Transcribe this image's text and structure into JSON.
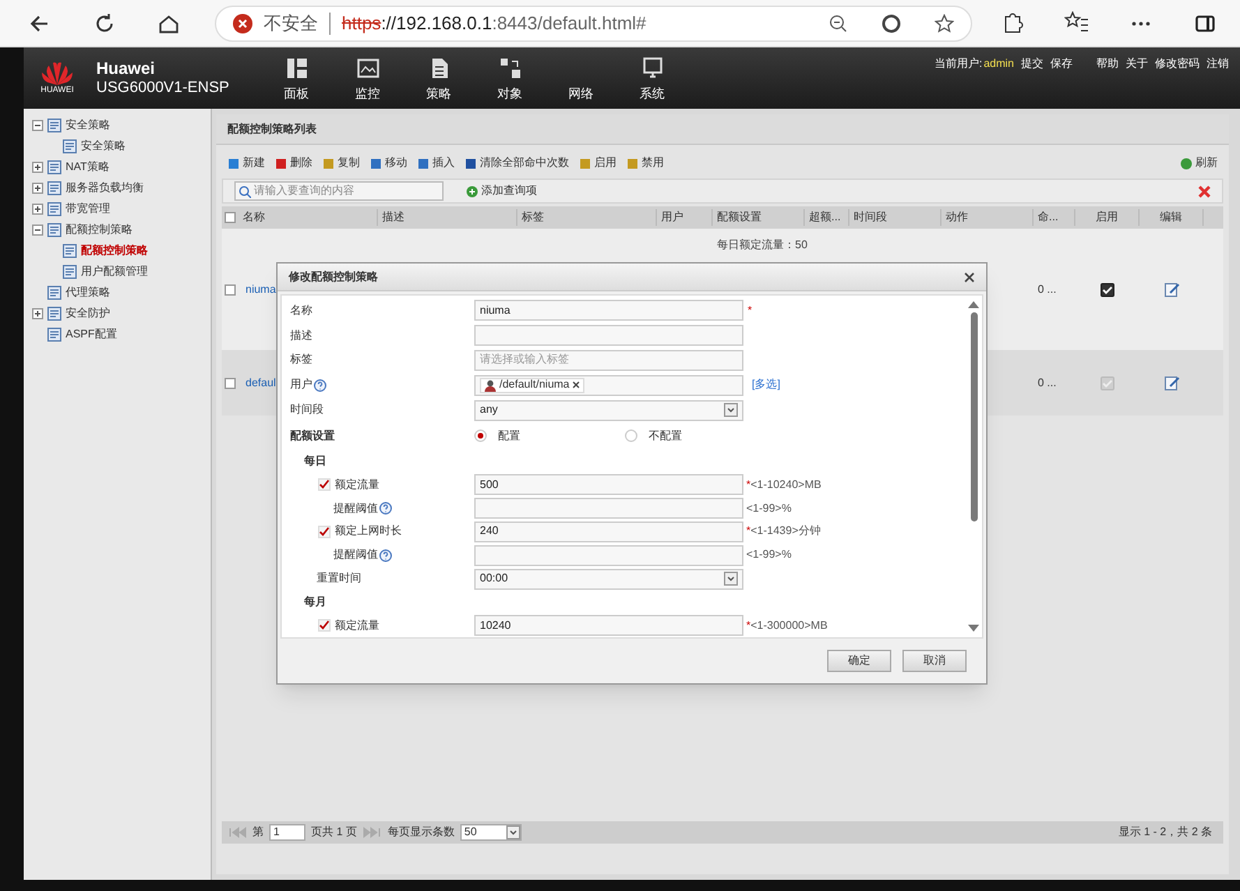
{
  "browser": {
    "insecure_label": "不安全",
    "url_scheme": "https",
    "url_host": "://192.168.0.1",
    "url_path": ":8443/default.html#"
  },
  "header": {
    "logo_text": "HUAWEI",
    "brand": "Huawei",
    "model": "USG6000V1-ENSP",
    "nav": [
      {
        "label": "面板"
      },
      {
        "label": "监控"
      },
      {
        "label": "策略"
      },
      {
        "label": "对象"
      },
      {
        "label": "网络"
      },
      {
        "label": "系统"
      }
    ],
    "user_label": "当前用户:",
    "user": "admin",
    "links": [
      "提交",
      "保存",
      "帮助",
      "关于",
      "修改密码",
      "注销"
    ]
  },
  "sidebar": {
    "items": [
      {
        "label": "安全策略",
        "expanded": true,
        "selected": false,
        "children": [
          {
            "label": "安全策略",
            "selected": false
          }
        ]
      },
      {
        "label": "NAT策略",
        "expanded": false,
        "selected": false
      },
      {
        "label": "服务器负载均衡",
        "expanded": false,
        "selected": false
      },
      {
        "label": "带宽管理",
        "expanded": false,
        "selected": false
      },
      {
        "label": "配额控制策略",
        "expanded": true,
        "selected": false,
        "children": [
          {
            "label": "配额控制策略",
            "selected": true
          },
          {
            "label": "用户配额管理",
            "selected": false
          }
        ]
      },
      {
        "label": "代理策略",
        "selected": false
      },
      {
        "label": "安全防护",
        "expanded": false,
        "selected": false
      },
      {
        "label": "ASPF配置",
        "selected": false
      }
    ]
  },
  "list": {
    "title": "配额控制策略列表",
    "toolbar": [
      "新建",
      "删除",
      "复制",
      "移动",
      "插入",
      "清除全部命中次数",
      "启用",
      "禁用"
    ],
    "refresh": "刷新",
    "search_placeholder": "请输入要查询的内容",
    "add_query": "添加查询项",
    "select_all_checked": false,
    "columns": [
      "名称",
      "描述",
      "标签",
      "用户",
      "配额设置",
      "超额...",
      "时间段",
      "动作",
      "命...",
      "启用",
      "编辑"
    ],
    "rows": [
      {
        "checked": false,
        "name": "niuma",
        "quota": "每日额定流量：50",
        "hits": "0 ...",
        "enabled": true,
        "disabled": false
      },
      {
        "checked": false,
        "name": "defaul",
        "quota": "",
        "hits": "0 ...",
        "enabled": true,
        "disabled": true
      }
    ],
    "pagination": {
      "page_label": "第",
      "page": "1",
      "page_of": "页共 1 页",
      "per_page_label": "每页显示条数",
      "per_page": "50",
      "summary": "显示 1 - 2，共 2 条"
    }
  },
  "dialog": {
    "title": "修改配额控制策略",
    "fields": [
      {
        "kind": "text",
        "label": "名称",
        "value": "niuma",
        "required_mark": "*"
      },
      {
        "kind": "text",
        "label": "描述"
      },
      {
        "kind": "text",
        "label": "标签",
        "placeholder": "请选择或输入标签"
      },
      {
        "kind": "user",
        "label": "用户",
        "help": true,
        "value": "/default/niuma",
        "link": "[多选]"
      },
      {
        "kind": "select",
        "label": "时间段",
        "value": "any"
      }
    ],
    "quota_label": "配额设置",
    "radios": [
      {
        "label": "配置",
        "selected": true
      },
      {
        "label": "不配置",
        "selected": false
      }
    ],
    "sections": [
      {
        "label": "每日",
        "rows": [
          {
            "kind": "check",
            "label": "额定流量",
            "checked": true,
            "value": "500",
            "required_mark": "*",
            "hint": "<1-10240>MB"
          },
          {
            "kind": "sub",
            "label": "提醒阈值",
            "hint": "<1-99>%"
          },
          {
            "kind": "check",
            "label": "额定上网时长",
            "checked": true,
            "value": "240",
            "required_mark": "*",
            "hint": "<1-1439>分钟"
          },
          {
            "kind": "sub",
            "label": "提醒阈值",
            "hint": "<1-99>%"
          },
          {
            "kind": "select",
            "label": "重置时间",
            "value": "00:00"
          }
        ]
      },
      {
        "label": "每月",
        "rows": [
          {
            "kind": "check",
            "label": "额定流量",
            "checked": true,
            "value": "10240",
            "required_mark": "*",
            "hint": "<1-300000>MB"
          }
        ]
      }
    ],
    "buttons": [
      "确定",
      "取消"
    ]
  }
}
